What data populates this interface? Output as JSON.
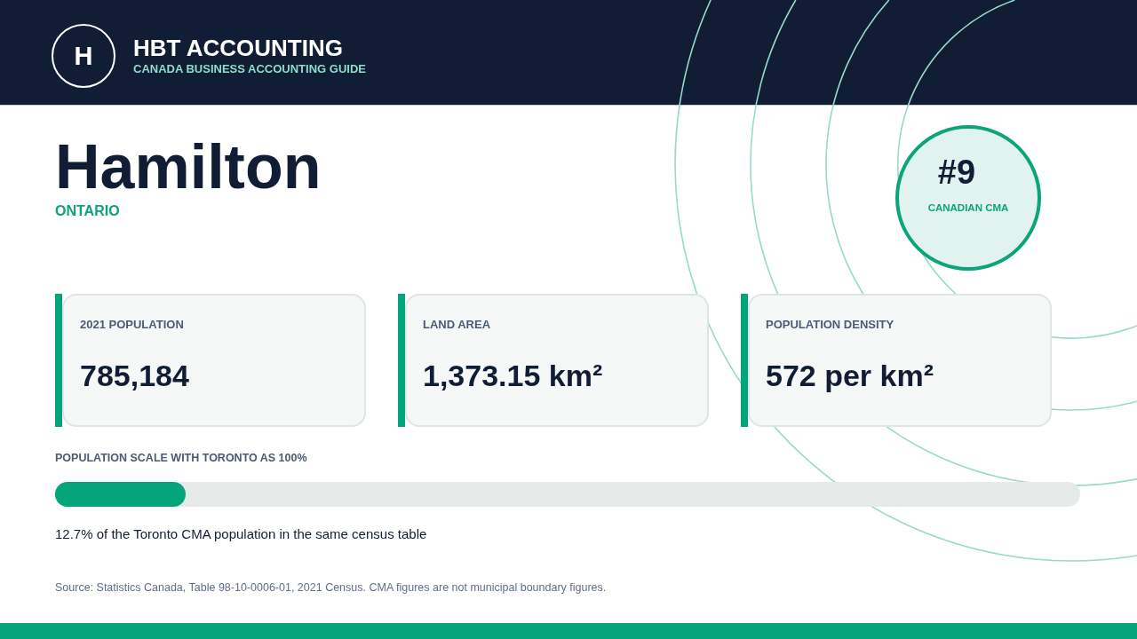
{
  "header": {
    "logo_letter": "H",
    "title": "HBT ACCOUNTING",
    "subtitle": "CANADA BUSINESS ACCOUNTING GUIDE"
  },
  "city": {
    "name": "Hamilton",
    "province": "ONTARIO"
  },
  "rank_badge": {
    "rank": "#9",
    "label": "CANADIAN CMA"
  },
  "stats": [
    {
      "label": "2021 POPULATION",
      "value": "785,184"
    },
    {
      "label": "LAND AREA",
      "value": "1,373.15 km²"
    },
    {
      "label": "POPULATION DENSITY",
      "value": "572 per km²"
    }
  ],
  "population_scale": {
    "title": "POPULATION SCALE WITH TORONTO AS 100%",
    "level": 0.127,
    "caption": "12.7% of the Toronto CMA population in the same census table"
  },
  "source_note": "Source: Statistics Canada, Table 98-10-0006-01, 2021 Census. CMA figures are not municipal boundary figures."
}
